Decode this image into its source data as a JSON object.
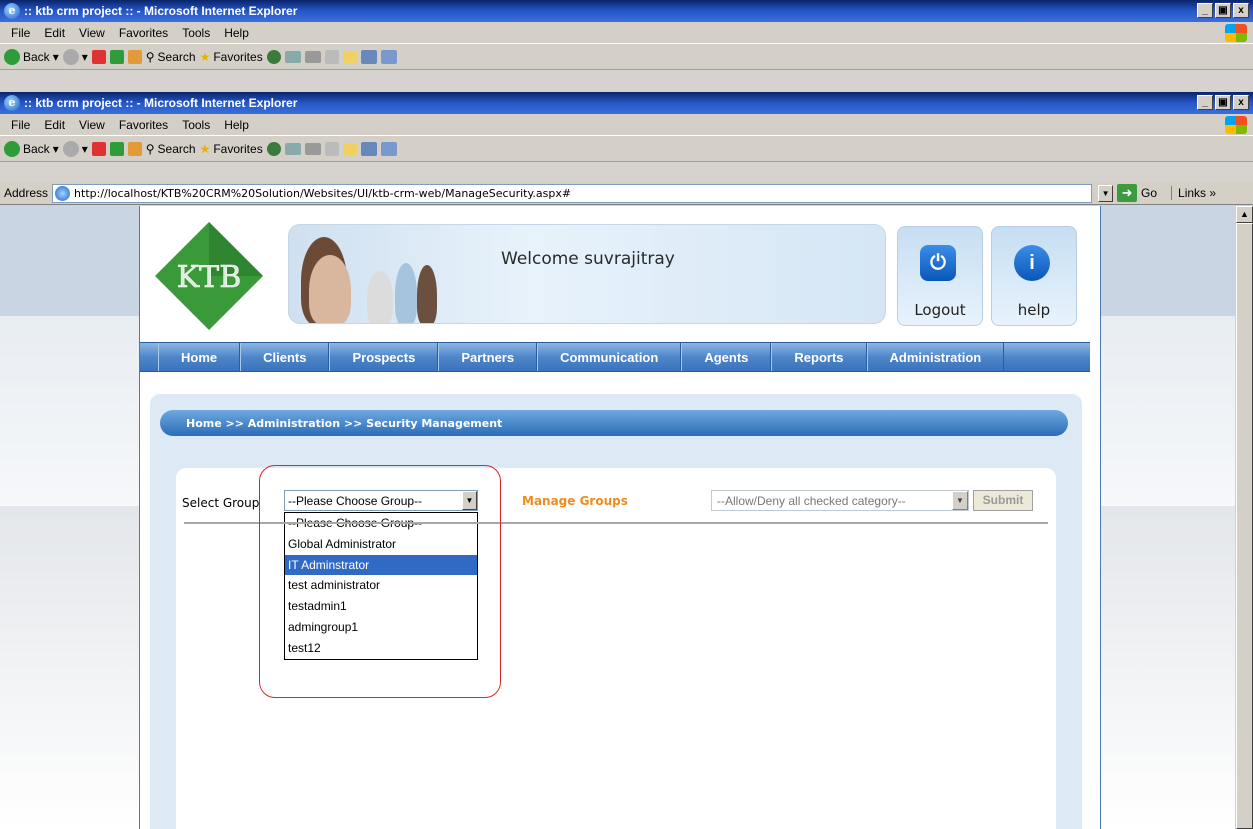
{
  "window": {
    "title": ":: ktb crm project :: - Microsoft Internet Explorer",
    "controls": [
      "_",
      "ð",
      "x"
    ]
  },
  "menu": {
    "items": [
      "File",
      "Edit",
      "View",
      "Favorites",
      "Tools",
      "Help"
    ]
  },
  "toolbar": {
    "back": "Back",
    "search": "Search",
    "favorites": "Favorites"
  },
  "address": {
    "label": "Address",
    "url": "http://localhost/KTB%20CRM%20Solution/Websites/UI/ktb-crm-web/ManageSecurity.aspx#",
    "go": "Go",
    "links": "Links"
  },
  "header": {
    "logo_text": "KTB",
    "welcome": "Welcome suvrajitray",
    "logout": "Logout",
    "help": "help"
  },
  "nav": {
    "items": [
      "Home",
      "Clients",
      "Prospects",
      "Partners",
      "Communication",
      "Agents",
      "Reports",
      "Administration"
    ]
  },
  "breadcrumb": "Home >> Administration >> Security Management",
  "form": {
    "select_group_label": "Select Group",
    "group_select_value": "--Please Choose Group--",
    "group_options": [
      "--Please Choose Group--",
      "Global Administrator",
      "IT Adminstrator",
      "test administrator",
      "testadmin1",
      "admingroup1",
      "test12"
    ],
    "highlighted_option": "IT Adminstrator",
    "manage_groups": "Manage Groups",
    "category_select_value": "--Allow/Deny all checked category--",
    "submit": "Submit"
  },
  "colors": {
    "accent": "#f08c1e",
    "nav": "#4f86c9",
    "highlight": "#316ac5",
    "annotation": "#d9262b"
  }
}
